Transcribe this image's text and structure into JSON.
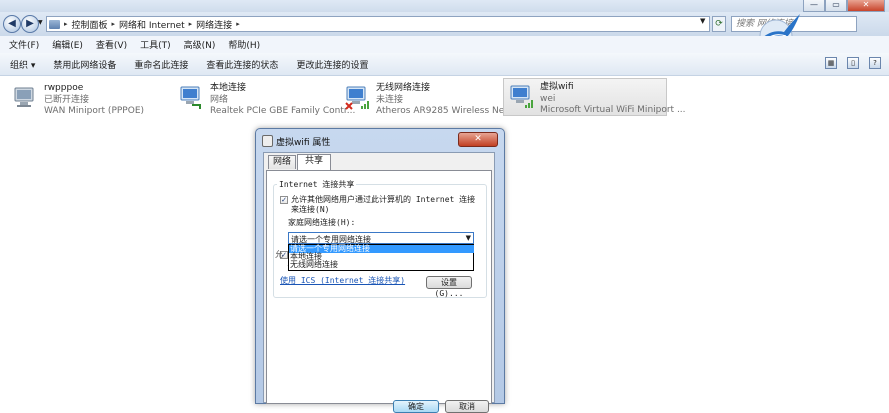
{
  "window": {
    "controls": {
      "minimize": "—",
      "maximize": "▭",
      "close": "✕"
    }
  },
  "address": {
    "crumbs": [
      "控制面板",
      "网络和 Internet",
      "网络连接"
    ],
    "search_placeholder": "搜索 网络连接"
  },
  "menu": [
    "文件(F)",
    "编辑(E)",
    "查看(V)",
    "工具(T)",
    "高级(N)",
    "帮助(H)"
  ],
  "commands": {
    "organize": "组织 ▾",
    "disable": "禁用此网络设备",
    "rename": "重命名此连接",
    "status": "查看此连接的状态",
    "change": "更改此连接的设置"
  },
  "connections": [
    {
      "name": "rwpppoe",
      "status": "已断开连接",
      "device": "WAN Miniport (PPPOE)"
    },
    {
      "name": "本地连接",
      "status": "网络",
      "device": "Realtek PCIe GBE Family Contr..."
    },
    {
      "name": "无线网络连接",
      "status": "未连接",
      "device": "Atheros AR9285 Wireless Net..."
    },
    {
      "name": "虚拟wifi",
      "status": "wei",
      "device": "Microsoft Virtual WiFi Miniport ..."
    }
  ],
  "dialog": {
    "title": "虚拟wifi 属性",
    "close": "✕",
    "tabs": [
      "网络",
      "共享"
    ],
    "group_title": "Internet 连接共享",
    "cb1_line1": "允许其他网络用户通过此计算机的 Internet 连接",
    "cb1_line2": "来连接(N)",
    "home_label": "家庭网络连接(H):",
    "select_value": "请选一个专用网络连接",
    "options": [
      "请选一个专用网络连接",
      "本地连接",
      "无线网络连接"
    ],
    "cb2_text": "允",
    "cb2_text2": "i",
    "link": "使用 ICS (Internet 连接共享)",
    "settings_btn": "设置(G)...",
    "ok": "确定",
    "cancel": "取消"
  }
}
